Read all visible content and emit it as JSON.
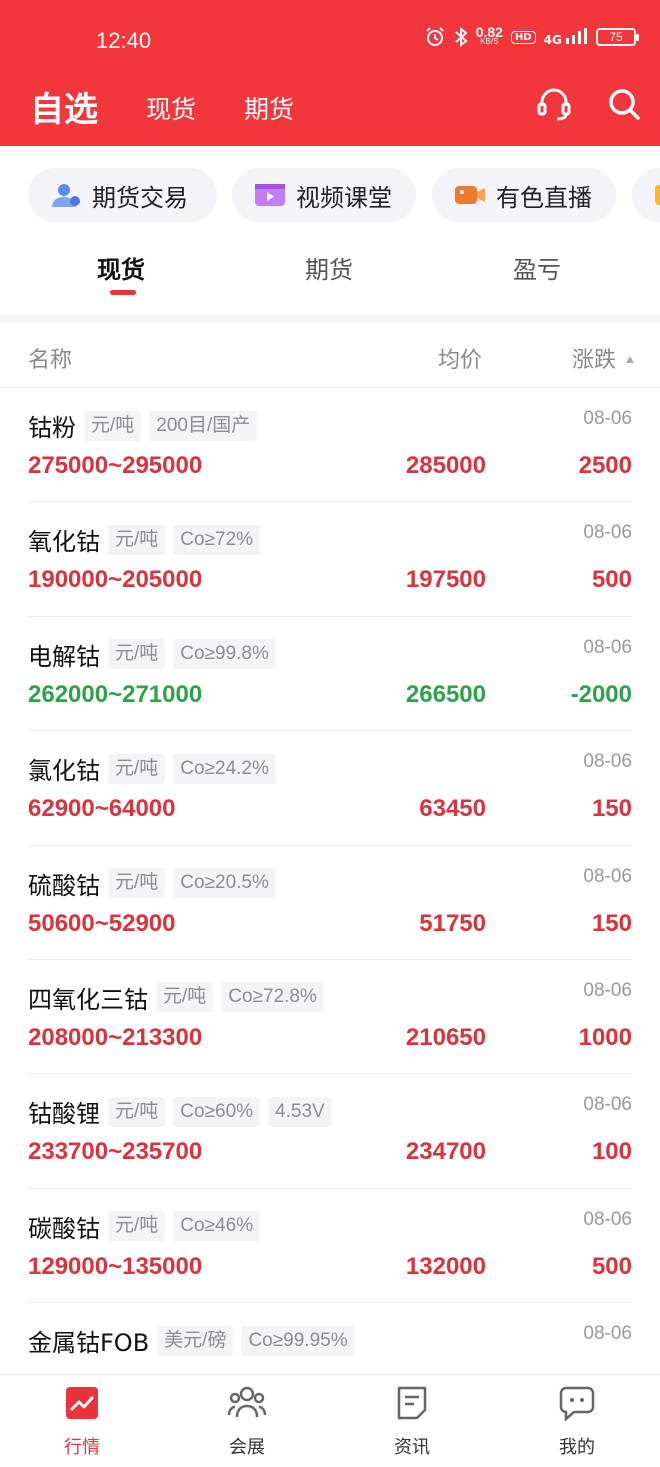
{
  "status_bar": {
    "time": "12:40",
    "net_speed": "0.82",
    "net_unit": "KB/S",
    "hd": "HD",
    "signal": "4G",
    "battery": "75"
  },
  "header": {
    "title": "自选",
    "tabs": [
      {
        "label": "现货"
      },
      {
        "label": "期货"
      }
    ],
    "icons": [
      "headset-icon",
      "search-icon"
    ]
  },
  "quick_links": [
    {
      "label": "期货交易",
      "icon": "user-icon",
      "color": "#5b8def"
    },
    {
      "label": "视频课堂",
      "icon": "video-icon",
      "color": "#b56bf0"
    },
    {
      "label": "有色直播",
      "icon": "camera-icon",
      "color": "#f07a2a"
    },
    {
      "label": "",
      "icon": "more-icon",
      "color": "#f5b82e"
    }
  ],
  "sub_tabs": [
    {
      "label": "现货",
      "active": true
    },
    {
      "label": "期货",
      "active": false
    },
    {
      "label": "盈亏",
      "active": false
    }
  ],
  "table": {
    "headers": {
      "name": "名称",
      "avg": "均价",
      "change": "涨跌"
    },
    "rows": [
      {
        "name": "钴粉",
        "tags": [
          "元/吨",
          "200目/国产"
        ],
        "date": "08-06",
        "range": "275000~295000",
        "avg": "285000",
        "change": "2500",
        "trend": "up"
      },
      {
        "name": "氧化钴",
        "tags": [
          "元/吨",
          "Co≥72%"
        ],
        "date": "08-06",
        "range": "190000~205000",
        "avg": "197500",
        "change": "500",
        "trend": "up"
      },
      {
        "name": "电解钴",
        "tags": [
          "元/吨",
          "Co≥99.8%"
        ],
        "date": "08-06",
        "range": "262000~271000",
        "avg": "266500",
        "change": "-2000",
        "trend": "down"
      },
      {
        "name": "氯化钴",
        "tags": [
          "元/吨",
          "Co≥24.2%"
        ],
        "date": "08-06",
        "range": "62900~64000",
        "avg": "63450",
        "change": "150",
        "trend": "up"
      },
      {
        "name": "硫酸钴",
        "tags": [
          "元/吨",
          "Co≥20.5%"
        ],
        "date": "08-06",
        "range": "50600~52900",
        "avg": "51750",
        "change": "150",
        "trend": "up"
      },
      {
        "name": "四氧化三钴",
        "tags": [
          "元/吨",
          "Co≥72.8%"
        ],
        "date": "08-06",
        "range": "208000~213300",
        "avg": "210650",
        "change": "1000",
        "trend": "up"
      },
      {
        "name": "钴酸锂",
        "tags": [
          "元/吨",
          "Co≥60%",
          "4.53V"
        ],
        "date": "08-06",
        "range": "233700~235700",
        "avg": "234700",
        "change": "100",
        "trend": "up"
      },
      {
        "name": "碳酸钴",
        "tags": [
          "元/吨",
          "Co≥46%"
        ],
        "date": "08-06",
        "range": "129000~135000",
        "avg": "132000",
        "change": "500",
        "trend": "up"
      },
      {
        "name": "金属钴FOB",
        "tags": [
          "美元/磅",
          "Co≥99.95%"
        ],
        "date": "08-06",
        "range": "",
        "avg": "",
        "change": "",
        "trend": "down"
      }
    ]
  },
  "bottom_nav": [
    {
      "label": "行情",
      "icon": "chart-icon",
      "active": true
    },
    {
      "label": "会展",
      "icon": "people-icon",
      "active": false
    },
    {
      "label": "资讯",
      "icon": "news-icon",
      "active": false
    },
    {
      "label": "我的",
      "icon": "profile-icon",
      "active": false
    }
  ],
  "colors": {
    "brand": "#f2373c",
    "up": "#d8343f",
    "down": "#2ea24a"
  }
}
